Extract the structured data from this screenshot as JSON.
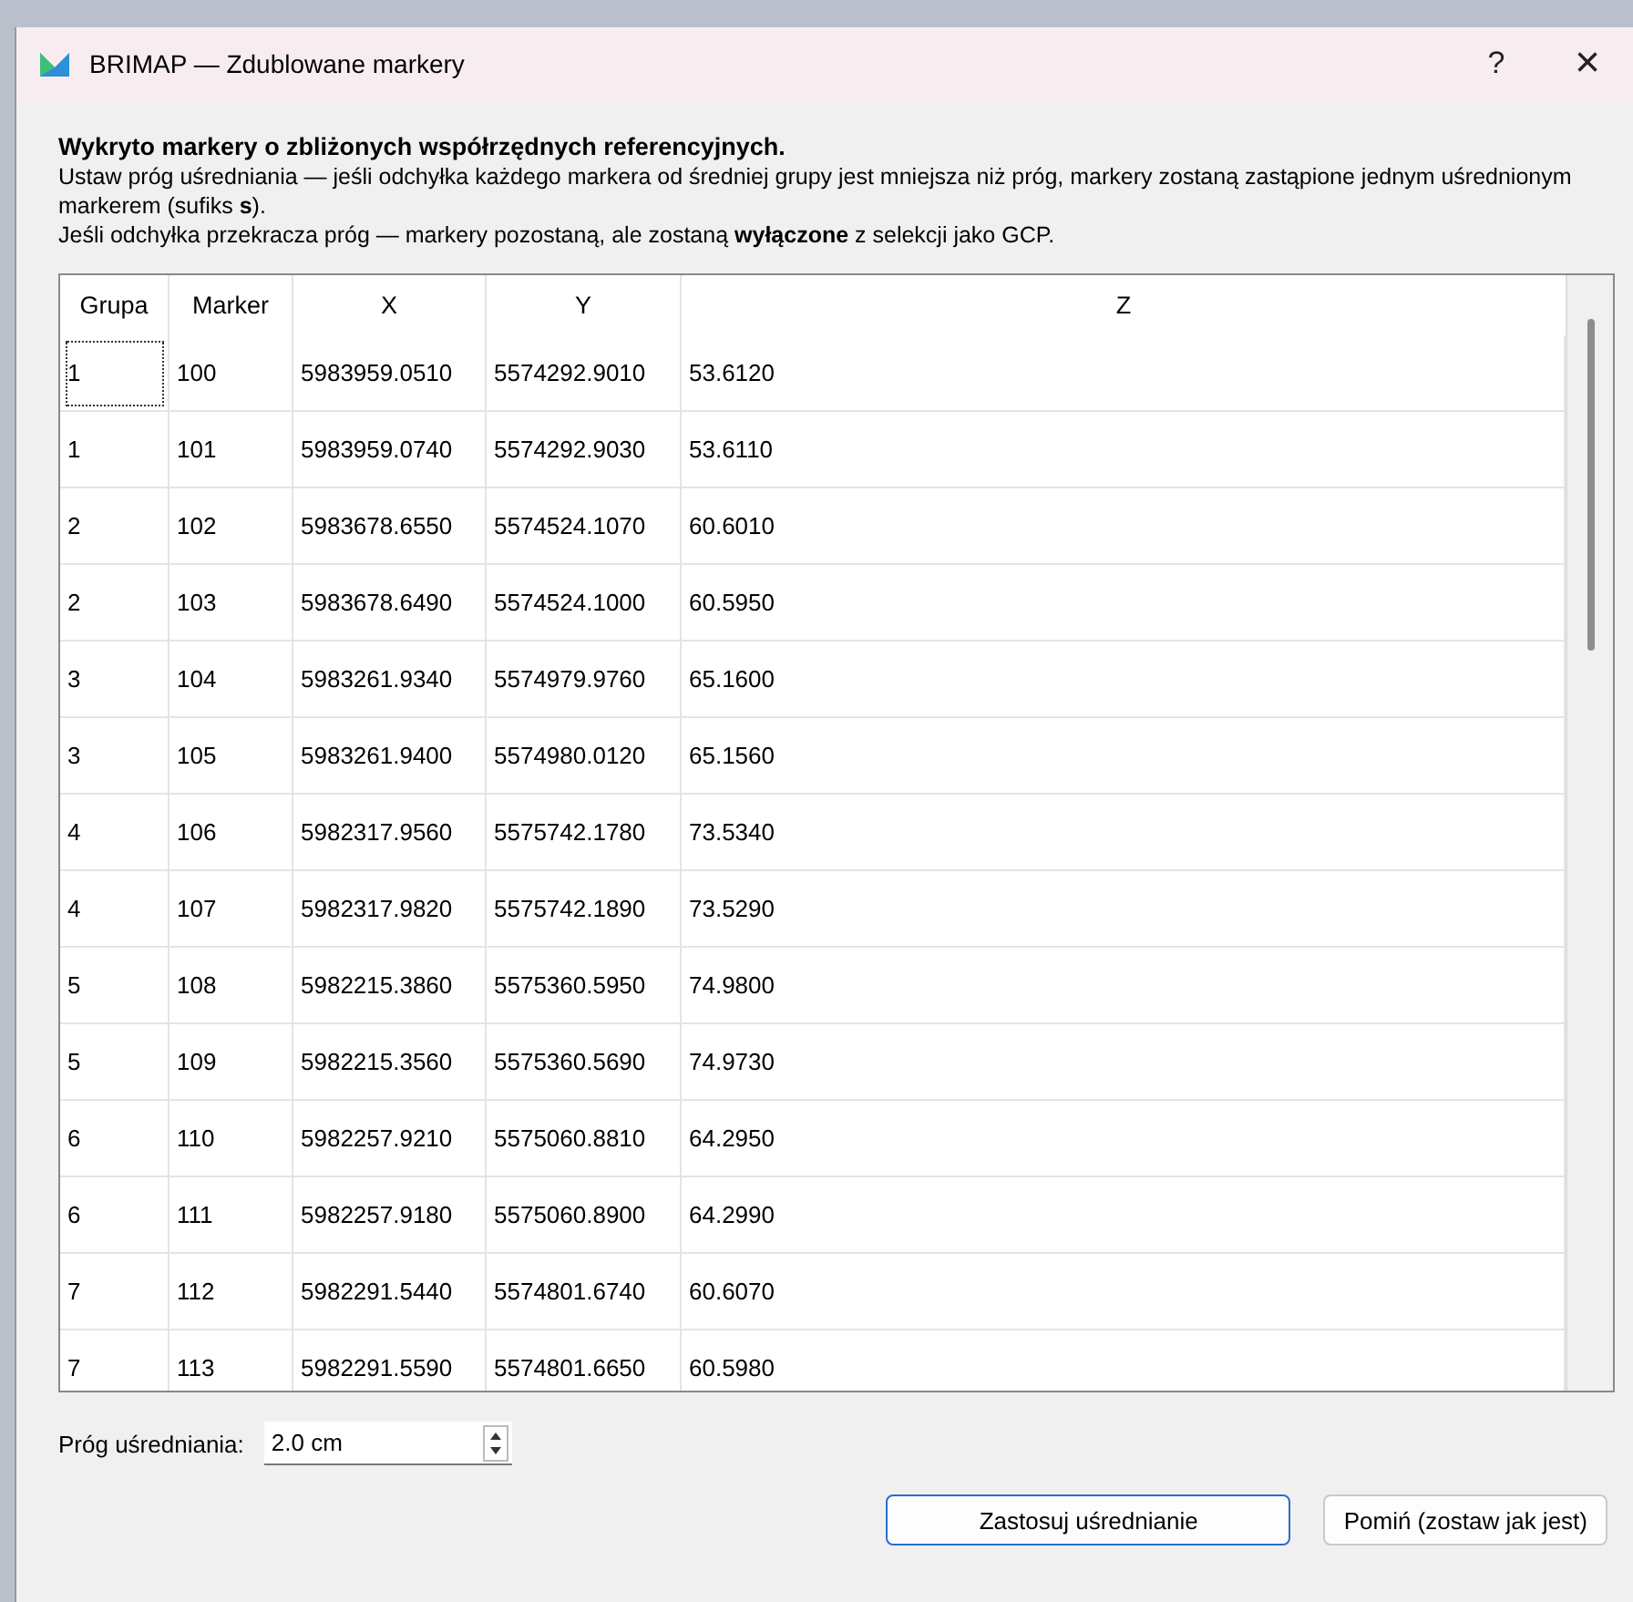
{
  "window": {
    "title": "BRIMAP — Zdublowane markery",
    "help": "?",
    "close": "×"
  },
  "message": {
    "heading": "Wykryto markery o zbliżonych współrzędnych referencyjnych.",
    "lines": [
      "Ustaw próg uśredniania — jeśli odchyłka każdego markera od średniej grupy jest mniejsza niż próg, markery zostaną zastąpione jednym uśrednionym markerem (sufiks **s**).",
      "Jeśli odchyłka przekracza próg — markery pozostaną, ale zostaną **wyłączone** z selekcji jako GCP."
    ]
  },
  "table": {
    "columns": [
      "Grupa",
      "Marker",
      "X",
      "Y",
      "Z"
    ],
    "rows": [
      {
        "cells": [
          "1",
          "100",
          "5983959.0510",
          "5574292.9010",
          "53.6120"
        ],
        "focused": true
      },
      {
        "cells": [
          "1",
          "101",
          "5983959.0740",
          "5574292.9030",
          "53.6110"
        ],
        "focused": false
      },
      {
        "cells": [
          "2",
          "102",
          "5983678.6550",
          "5574524.1070",
          "60.6010"
        ],
        "focused": false
      },
      {
        "cells": [
          "2",
          "103",
          "5983678.6490",
          "5574524.1000",
          "60.5950"
        ],
        "focused": false
      },
      {
        "cells": [
          "3",
          "104",
          "5983261.9340",
          "5574979.9760",
          "65.1600"
        ],
        "focused": false
      },
      {
        "cells": [
          "3",
          "105",
          "5983261.9400",
          "5574980.0120",
          "65.1560"
        ],
        "focused": false
      },
      {
        "cells": [
          "4",
          "106",
          "5982317.9560",
          "5575742.1780",
          "73.5340"
        ],
        "focused": false
      },
      {
        "cells": [
          "4",
          "107",
          "5982317.9820",
          "5575742.1890",
          "73.5290"
        ],
        "focused": false
      },
      {
        "cells": [
          "5",
          "108",
          "5982215.3860",
          "5575360.5950",
          "74.9800"
        ],
        "focused": false
      },
      {
        "cells": [
          "5",
          "109",
          "5982215.3560",
          "5575360.5690",
          "74.9730"
        ],
        "focused": false
      },
      {
        "cells": [
          "6",
          "110",
          "5982257.9210",
          "5575060.8810",
          "64.2950"
        ],
        "focused": false
      },
      {
        "cells": [
          "6",
          "111",
          "5982257.9180",
          "5575060.8900",
          "64.2990"
        ],
        "focused": false
      },
      {
        "cells": [
          "7",
          "112",
          "5982291.5440",
          "5574801.6740",
          "60.6070"
        ],
        "focused": false
      },
      {
        "cells": [
          "7",
          "113",
          "5982291.5590",
          "5574801.6650",
          "60.5980"
        ],
        "focused": false
      }
    ]
  },
  "threshold": {
    "label": "Próg uśredniania:",
    "value": "2.0 cm"
  },
  "buttons": [
    {
      "label": "Zastosuj uśrednianie",
      "default": true
    },
    {
      "label": "Pomiń (zostaw jak jest)",
      "default": false
    }
  ]
}
